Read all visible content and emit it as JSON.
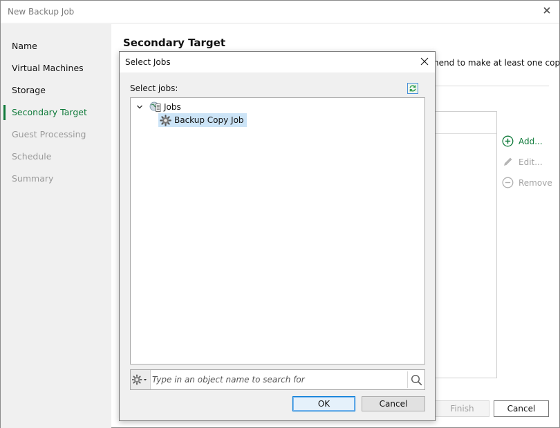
{
  "window": {
    "title": "New Backup Job"
  },
  "nav": {
    "items": [
      {
        "label": "Name",
        "state": "normal"
      },
      {
        "label": "Virtual Machines",
        "state": "normal"
      },
      {
        "label": "Storage",
        "state": "normal"
      },
      {
        "label": "Secondary Target",
        "state": "active"
      },
      {
        "label": "Guest Processing",
        "state": "disabled"
      },
      {
        "label": "Schedule",
        "state": "disabled"
      },
      {
        "label": "Summary",
        "state": "disabled"
      }
    ]
  },
  "page": {
    "title": "Secondary Target",
    "description_fragment": "nend to make at least one copy"
  },
  "side_buttons": {
    "add": "Add...",
    "edit": "Edit...",
    "remove": "Remove"
  },
  "footer": {
    "finish": "Finish",
    "cancel": "Cancel"
  },
  "dialog": {
    "title": "Select Jobs",
    "label": "Select jobs:",
    "tree": {
      "root": {
        "label": "Jobs",
        "expanded": true
      },
      "children": [
        {
          "label": "Backup Copy Job",
          "selected": true
        }
      ]
    },
    "search": {
      "placeholder": "Type in an object name to search for",
      "value": ""
    },
    "ok": "OK",
    "cancel": "Cancel"
  },
  "colors": {
    "accent_green": "#0f7a3a",
    "selection_blue": "#cce4f7",
    "focus_blue": "#0078d7"
  },
  "icons": {
    "window_close": "close-icon",
    "dialog_close": "close-icon",
    "refresh": "refresh-icon",
    "tree_expand": "chevron-down-icon",
    "jobs": "jobs-folder-icon",
    "job": "gear-icon",
    "search_options": "gear-dropdown-icon",
    "search": "search-icon",
    "add": "plus-circle-icon",
    "edit": "pencil-icon",
    "remove": "minus-circle-icon"
  }
}
